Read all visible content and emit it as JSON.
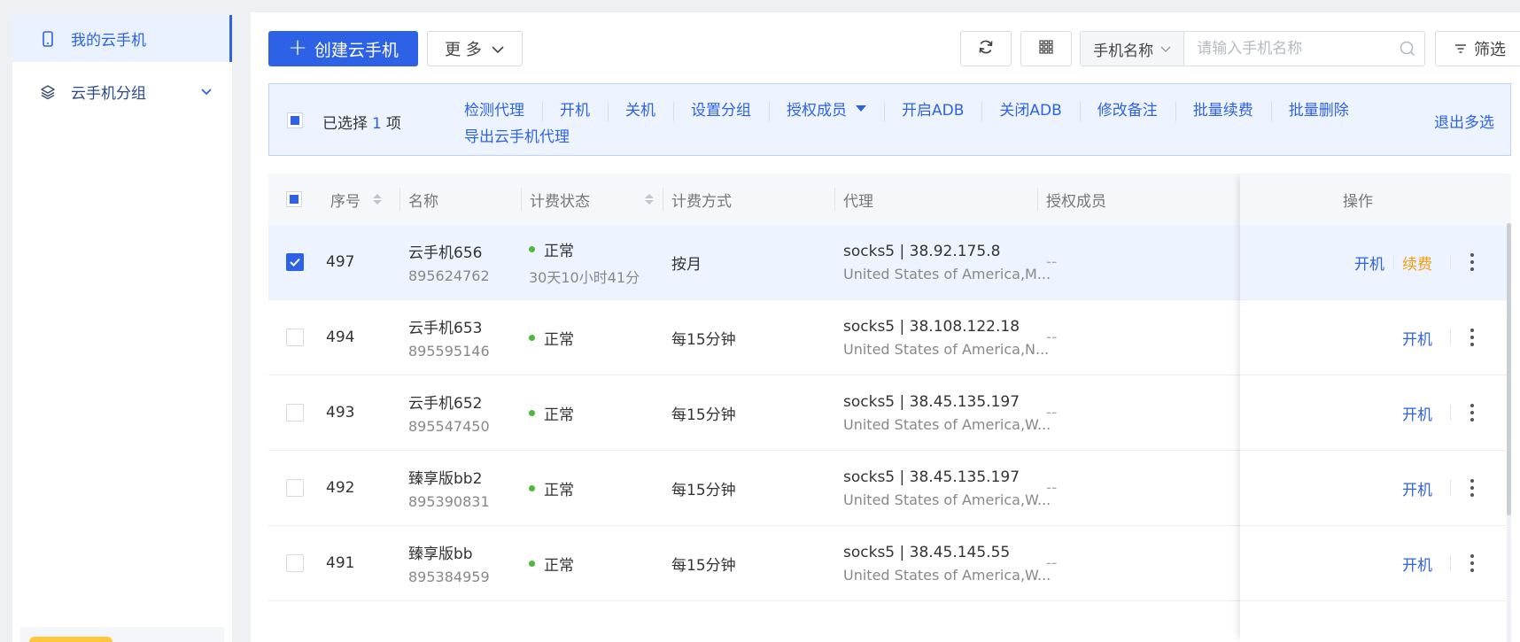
{
  "sidebar": {
    "items": [
      {
        "label": "我的云手机",
        "icon": "phone-icon",
        "active": true
      },
      {
        "label": "云手机分组",
        "icon": "layers-icon",
        "active": false
      }
    ]
  },
  "toolbar": {
    "create_label": "创建云手机",
    "more_label": "更 多",
    "search_select_label": "手机名称",
    "search_placeholder": "请输入手机名称",
    "filter_label": "筛选"
  },
  "selection": {
    "prefix": "已选择",
    "count": "1",
    "suffix": "项",
    "actions_row1": [
      "检测代理",
      "开机",
      "关机",
      "设置分组",
      "授权成员",
      "开启ADB",
      "关闭ADB",
      "修改备注",
      "批量续费",
      "批量删除"
    ],
    "actions_row2": [
      "导出云手机代理"
    ],
    "exit_label": "退出多选"
  },
  "table": {
    "headers": {
      "index": "序号",
      "name": "名称",
      "billing_status": "计费状态",
      "billing_method": "计费方式",
      "proxy": "代理",
      "members": "授权成员",
      "ops": "操作"
    },
    "rows": [
      {
        "checked": true,
        "index": "497",
        "name": "云手机656",
        "id": "895624762",
        "status": "正常",
        "status_sub": "30天10小时41分",
        "method": "按月",
        "proxy": "socks5 | 38.92.175.8",
        "proxy_sub": "United States of America,M...",
        "members": "--",
        "ops": [
          "开机",
          "续费"
        ]
      },
      {
        "checked": false,
        "index": "494",
        "name": "云手机653",
        "id": "895595146",
        "status": "正常",
        "status_sub": "",
        "method": "每15分钟",
        "proxy": "socks5 | 38.108.122.18",
        "proxy_sub": "United States of America,N...",
        "members": "--",
        "ops": [
          "开机"
        ]
      },
      {
        "checked": false,
        "index": "493",
        "name": "云手机652",
        "id": "895547450",
        "status": "正常",
        "status_sub": "",
        "method": "每15分钟",
        "proxy": "socks5 | 38.45.135.197",
        "proxy_sub": "United States of America,W...",
        "members": "--",
        "ops": [
          "开机"
        ]
      },
      {
        "checked": false,
        "index": "492",
        "name": "臻享版bb2",
        "id": "895390831",
        "status": "正常",
        "status_sub": "",
        "method": "每15分钟",
        "proxy": "socks5 | 38.45.135.197",
        "proxy_sub": "United States of America,W...",
        "members": "--",
        "ops": [
          "开机"
        ]
      },
      {
        "checked": false,
        "index": "491",
        "name": "臻享版bb",
        "id": "895384959",
        "status": "正常",
        "status_sub": "",
        "method": "每15分钟",
        "proxy": "socks5 | 38.45.145.55",
        "proxy_sub": "United States of America,W...",
        "members": "--",
        "ops": [
          "开机"
        ]
      }
    ]
  },
  "colors": {
    "primary": "#2e62e6",
    "renew": "#f39c12",
    "status_ok": "#4cba38",
    "selected_row": "#eef4ff"
  }
}
